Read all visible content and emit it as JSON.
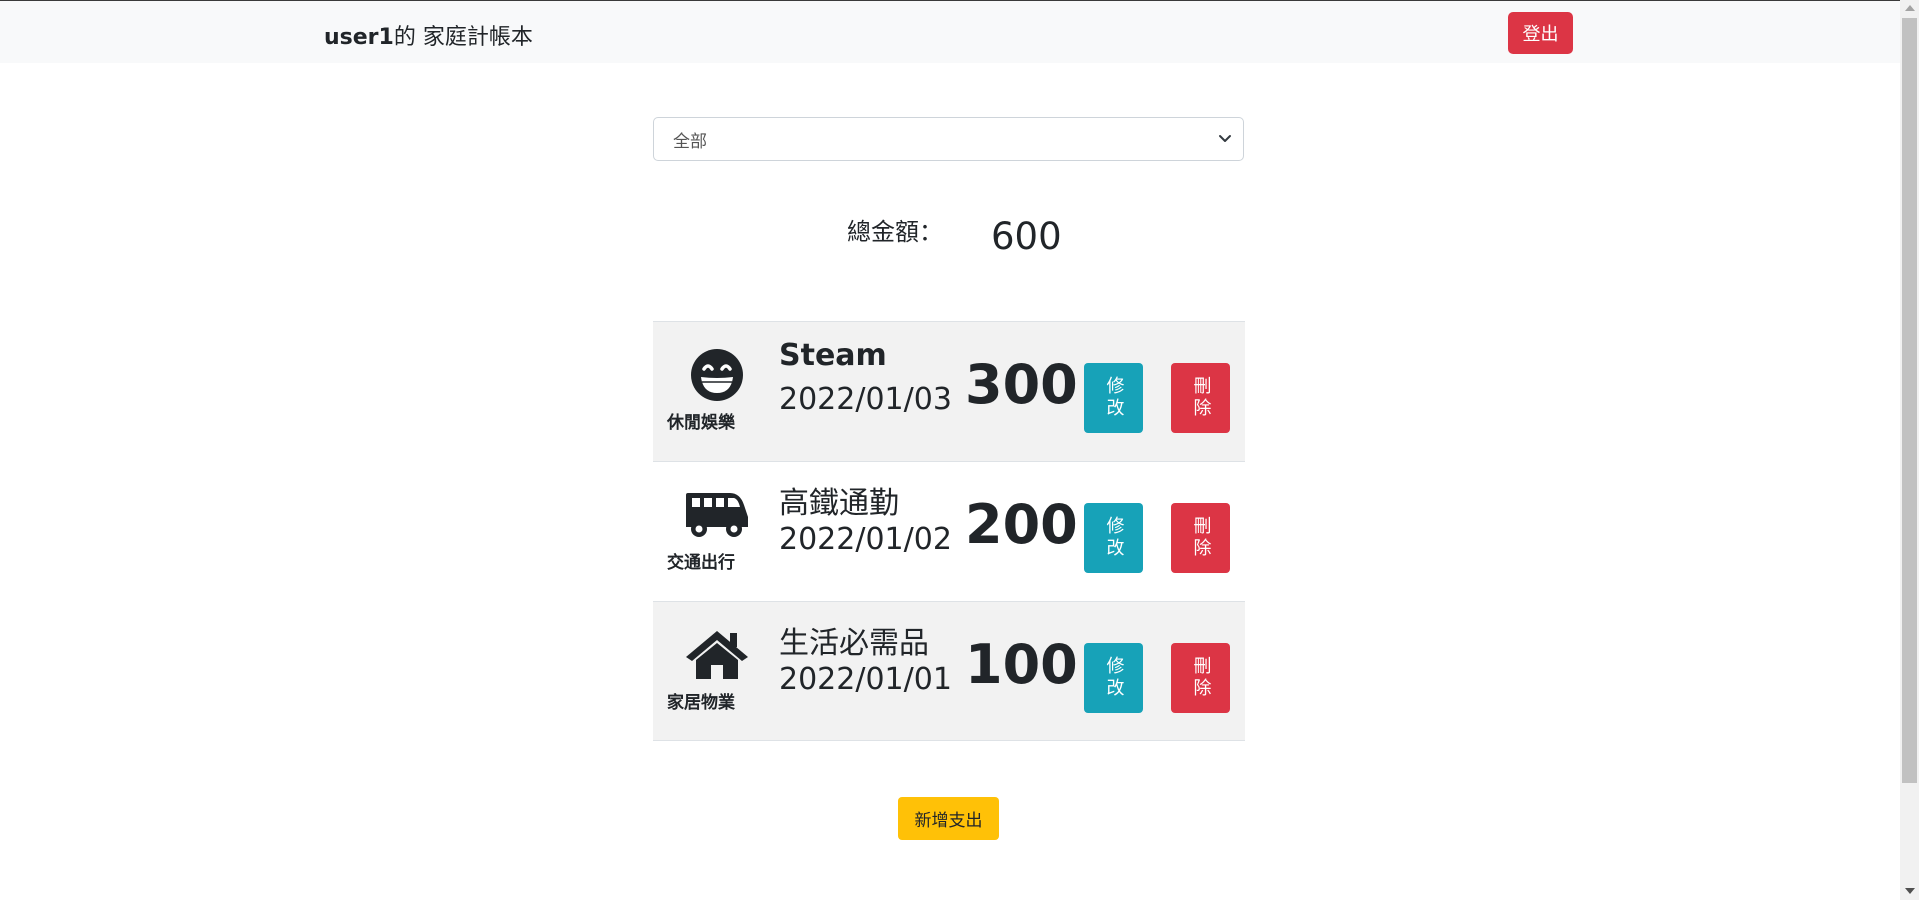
{
  "navbar": {
    "username": "user1",
    "title": "的 家庭計帳本",
    "logout_label": "登出"
  },
  "filter": {
    "selected": "全部"
  },
  "summary": {
    "label": "總金額：",
    "value": "600"
  },
  "expenses": [
    {
      "icon": "grin-icon",
      "category": "休閒娛樂",
      "name": "Steam",
      "date": "2022/01/03",
      "amount": "300",
      "edit_label": "修改",
      "delete_label": "刪除"
    },
    {
      "icon": "bus-icon",
      "category": "交通出行",
      "name": "高鐵通勤",
      "date": "2022/01/02",
      "amount": "200",
      "edit_label": "修改",
      "delete_label": "刪除"
    },
    {
      "icon": "home-icon",
      "category": "家居物業",
      "name": "生活必需品",
      "date": "2022/01/01",
      "amount": "100",
      "edit_label": "修改",
      "delete_label": "刪除"
    }
  ],
  "add_button_label": "新增支出",
  "colors": {
    "danger": "#dc3545",
    "info": "#17a2b8",
    "warning": "#ffc107",
    "navbar_bg": "#f8f9fa",
    "row_shade": "#f2f2f2"
  }
}
